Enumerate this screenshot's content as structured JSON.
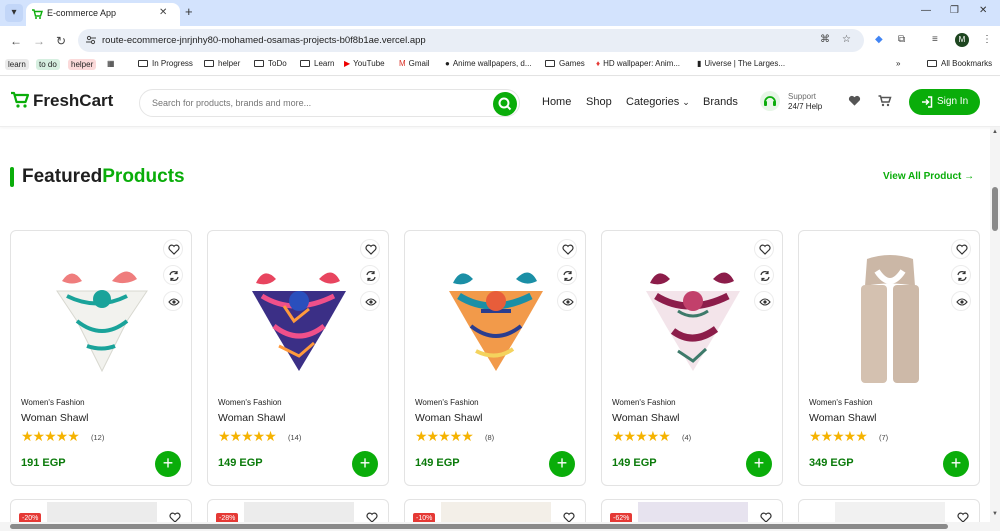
{
  "browser": {
    "tab_title": "E-commerce App",
    "url": "route-ecommerce-jnrjnhy80-mohamed-osamas-projects-b0f8b1ae.vercel.app",
    "avatar_letter": "M"
  },
  "bookmarks": {
    "chips": [
      "learn",
      "to do",
      "helper"
    ],
    "items": [
      "In Progress",
      "helper",
      "ToDo",
      "Learn",
      "YouTube",
      "Gmail",
      "Anime wallpapers, d...",
      "Games",
      "HD wallpaper: Anim...",
      "Uiverse | The Larges..."
    ],
    "all_bookmarks": "All Bookmarks"
  },
  "site": {
    "brand": "FreshCart",
    "search_placeholder": "Search for products, brands and more...",
    "nav": [
      "Home",
      "Shop",
      "Categories",
      "Brands"
    ],
    "support_line1": "Support",
    "support_line2": "24/7 Help",
    "signin_label": "Sign In",
    "accent_color": "#0aad0a"
  },
  "section": {
    "title_part1": "Featured",
    "title_part2": "Products",
    "view_all": "View All Product"
  },
  "products": [
    {
      "category": "Women's Fashion",
      "name": "Woman Shawl",
      "stars": "★★★★★",
      "reviews": "(12)",
      "price": "191 EGP"
    },
    {
      "category": "Women's Fashion",
      "name": "Woman Shawl",
      "stars": "★★★★★",
      "reviews": "(14)",
      "price": "149 EGP"
    },
    {
      "category": "Women's Fashion",
      "name": "Woman Shawl",
      "stars": "★★★★★",
      "reviews": "(8)",
      "price": "149 EGP"
    },
    {
      "category": "Women's Fashion",
      "name": "Woman Shawl",
      "stars": "★★★★★",
      "reviews": "(4)",
      "price": "149 EGP"
    },
    {
      "category": "Women's Fashion",
      "name": "Woman Shawl",
      "stars": "★★★★★",
      "reviews": "(7)",
      "price": "349 EGP"
    }
  ],
  "row2_badges": [
    "-20%",
    "-28%",
    "-10%",
    "-62%",
    ""
  ]
}
